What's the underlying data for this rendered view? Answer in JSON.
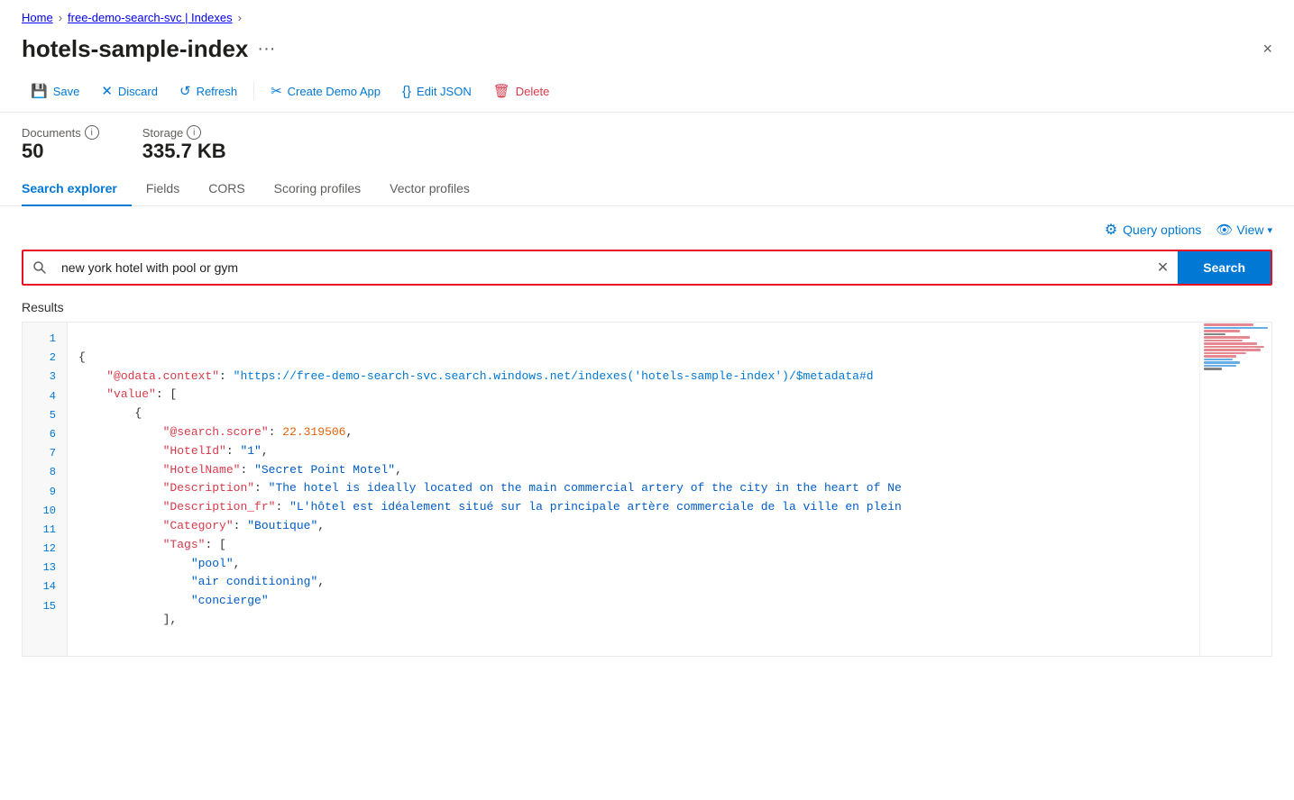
{
  "breadcrumb": {
    "home": "Home",
    "separator1": ">",
    "service": "free-demo-search-svc | Indexes",
    "separator2": ">",
    "current": ""
  },
  "header": {
    "title": "hotels-sample-index",
    "ellipsis": "···",
    "close_label": "×"
  },
  "toolbar": {
    "save": "Save",
    "discard": "Discard",
    "refresh": "Refresh",
    "create_demo_app": "Create Demo App",
    "edit_json": "Edit JSON",
    "delete": "Delete"
  },
  "stats": {
    "documents_label": "Documents",
    "documents_value": "50",
    "storage_label": "Storage",
    "storage_value": "335.7 KB"
  },
  "tabs": [
    {
      "id": "search-explorer",
      "label": "Search explorer",
      "active": true
    },
    {
      "id": "fields",
      "label": "Fields",
      "active": false
    },
    {
      "id": "cors",
      "label": "CORS",
      "active": false
    },
    {
      "id": "scoring-profiles",
      "label": "Scoring profiles",
      "active": false
    },
    {
      "id": "vector-profiles",
      "label": "Vector profiles",
      "active": false
    }
  ],
  "query_options_label": "Query options",
  "view_label": "View",
  "search": {
    "placeholder": "Search",
    "value": "new york hotel with pool or gym",
    "button_label": "Search"
  },
  "results_label": "Results",
  "code_lines": [
    {
      "num": "1",
      "content": "{"
    },
    {
      "num": "2",
      "content": "    \"@odata.context\": \"https://free-demo-search-svc.search.windows.net/indexes('hotels-sample-index')/$metadata#d"
    },
    {
      "num": "3",
      "content": "    \"value\": ["
    },
    {
      "num": "4",
      "content": "        {"
    },
    {
      "num": "5",
      "content": "            \"@search.score\": 22.319506,"
    },
    {
      "num": "6",
      "content": "            \"HotelId\": \"1\","
    },
    {
      "num": "7",
      "content": "            \"HotelName\": \"Secret Point Motel\","
    },
    {
      "num": "8",
      "content": "            \"Description\": \"The hotel is ideally located on the main commercial artery of the city in the heart of Ne"
    },
    {
      "num": "9",
      "content": "            \"Description_fr\": \"L'hôtel est idéalement situé sur la principale artère commerciale de la ville en plein"
    },
    {
      "num": "10",
      "content": "            \"Category\": \"Boutique\","
    },
    {
      "num": "11",
      "content": "            \"Tags\": ["
    },
    {
      "num": "12",
      "content": "                \"pool\","
    },
    {
      "num": "13",
      "content": "                \"air conditioning\","
    },
    {
      "num": "14",
      "content": "                \"concierge\""
    },
    {
      "num": "15",
      "content": "            ],"
    }
  ]
}
